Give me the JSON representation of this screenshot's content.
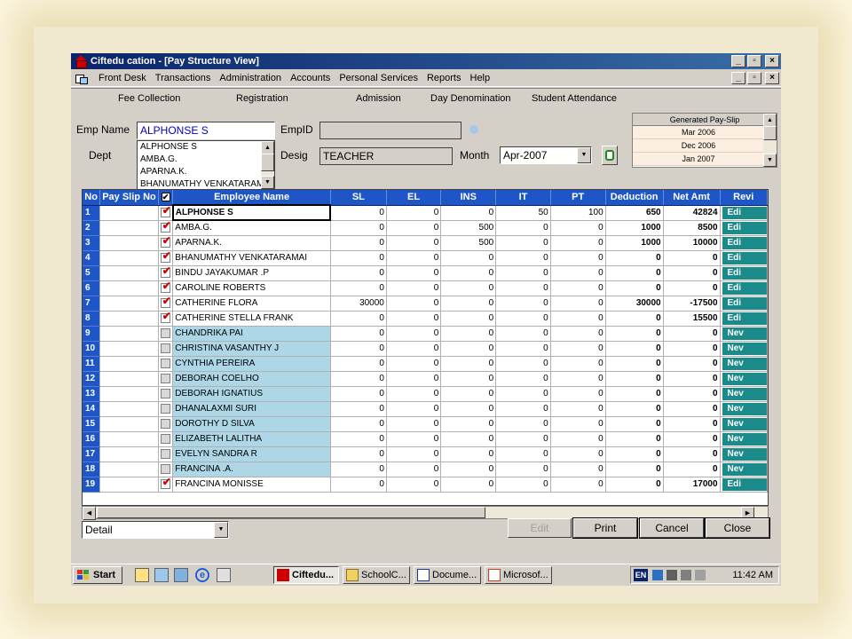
{
  "window": {
    "title": "Ciftedu cation - [Pay Structure View]"
  },
  "menu": [
    "Front Desk",
    "Transactions",
    "Administration",
    "Accounts",
    "Personal Services",
    "Reports",
    "Help"
  ],
  "toolbar": [
    "Fee Collection",
    "Registration",
    "Admission",
    "Day Denomination",
    "Student Attendance"
  ],
  "form": {
    "emp_name_label": "Emp Name",
    "emp_name_value": "ALPHONSE S",
    "empid_label": "EmpID",
    "empid_value": "",
    "dept_label": "Dept",
    "desig_label": "Desig",
    "desig_value": "TEACHER",
    "month_label": "Month",
    "month_value": "Apr-2007",
    "emp_list": [
      "ALPHONSE S",
      "AMBA.G.",
      "APARNA.K.",
      "BHANUMATHY VENKATARAMA"
    ]
  },
  "payslip": {
    "header": "Generated Pay-Slip",
    "items": [
      "Mar 2006",
      "Dec 2006",
      "Jan 2007"
    ]
  },
  "grid": {
    "headers": [
      "No",
      "Pay Slip No",
      "✔",
      "Employee Name",
      "SL",
      "EL",
      "INS",
      "IT",
      "PT",
      "Deduction",
      "Net Amt",
      "Revi"
    ],
    "rows": [
      {
        "no": "1",
        "checked": true,
        "name": "ALPHONSE S",
        "sl": "0",
        "el": "0",
        "ins": "0",
        "it": "50",
        "pt": "100",
        "ded": "650",
        "net": "42824",
        "action": "Edi"
      },
      {
        "no": "2",
        "checked": true,
        "name": "AMBA.G.",
        "sl": "0",
        "el": "0",
        "ins": "500",
        "it": "0",
        "pt": "0",
        "ded": "1000",
        "net": "8500",
        "action": "Edi"
      },
      {
        "no": "3",
        "checked": true,
        "name": "APARNA.K.",
        "sl": "0",
        "el": "0",
        "ins": "500",
        "it": "0",
        "pt": "0",
        "ded": "1000",
        "net": "10000",
        "action": "Edi"
      },
      {
        "no": "4",
        "checked": true,
        "name": "BHANUMATHY VENKATARAMAI",
        "sl": "0",
        "el": "0",
        "ins": "0",
        "it": "0",
        "pt": "0",
        "ded": "0",
        "net": "0",
        "action": "Edi"
      },
      {
        "no": "5",
        "checked": true,
        "name": "BINDU JAYAKUMAR .P",
        "sl": "0",
        "el": "0",
        "ins": "0",
        "it": "0",
        "pt": "0",
        "ded": "0",
        "net": "0",
        "action": "Edi"
      },
      {
        "no": "6",
        "checked": true,
        "name": "CAROLINE ROBERTS",
        "sl": "0",
        "el": "0",
        "ins": "0",
        "it": "0",
        "pt": "0",
        "ded": "0",
        "net": "0",
        "action": "Edi"
      },
      {
        "no": "7",
        "checked": true,
        "name": "CATHERINE FLORA",
        "sl": "30000",
        "el": "0",
        "ins": "0",
        "it": "0",
        "pt": "0",
        "ded": "30000",
        "net": "-17500",
        "action": "Edi"
      },
      {
        "no": "8",
        "checked": true,
        "name": "CATHERINE STELLA FRANK",
        "sl": "0",
        "el": "0",
        "ins": "0",
        "it": "0",
        "pt": "0",
        "ded": "0",
        "net": "15500",
        "action": "Edi"
      },
      {
        "no": "9",
        "checked": false,
        "name": "CHANDRIKA PAI",
        "sl": "0",
        "el": "0",
        "ins": "0",
        "it": "0",
        "pt": "0",
        "ded": "0",
        "net": "0",
        "action": "Nev"
      },
      {
        "no": "10",
        "checked": false,
        "name": "CHRISTINA VASANTHY J",
        "sl": "0",
        "el": "0",
        "ins": "0",
        "it": "0",
        "pt": "0",
        "ded": "0",
        "net": "0",
        "action": "Nev"
      },
      {
        "no": "11",
        "checked": false,
        "name": "CYNTHIA PEREIRA",
        "sl": "0",
        "el": "0",
        "ins": "0",
        "it": "0",
        "pt": "0",
        "ded": "0",
        "net": "0",
        "action": "Nev"
      },
      {
        "no": "12",
        "checked": false,
        "name": "DEBORAH COELHO",
        "sl": "0",
        "el": "0",
        "ins": "0",
        "it": "0",
        "pt": "0",
        "ded": "0",
        "net": "0",
        "action": "Nev"
      },
      {
        "no": "13",
        "checked": false,
        "name": "DEBORAH IGNATIUS",
        "sl": "0",
        "el": "0",
        "ins": "0",
        "it": "0",
        "pt": "0",
        "ded": "0",
        "net": "0",
        "action": "Nev"
      },
      {
        "no": "14",
        "checked": false,
        "name": "DHANALAXMI SURI",
        "sl": "0",
        "el": "0",
        "ins": "0",
        "it": "0",
        "pt": "0",
        "ded": "0",
        "net": "0",
        "action": "Nev"
      },
      {
        "no": "15",
        "checked": false,
        "name": "DOROTHY D SILVA",
        "sl": "0",
        "el": "0",
        "ins": "0",
        "it": "0",
        "pt": "0",
        "ded": "0",
        "net": "0",
        "action": "Nev"
      },
      {
        "no": "16",
        "checked": false,
        "name": "ELIZABETH LALITHA",
        "sl": "0",
        "el": "0",
        "ins": "0",
        "it": "0",
        "pt": "0",
        "ded": "0",
        "net": "0",
        "action": "Nev"
      },
      {
        "no": "17",
        "checked": false,
        "name": "EVELYN SANDRA R",
        "sl": "0",
        "el": "0",
        "ins": "0",
        "it": "0",
        "pt": "0",
        "ded": "0",
        "net": "0",
        "action": "Nev"
      },
      {
        "no": "18",
        "checked": false,
        "name": "FRANCINA .A.",
        "sl": "0",
        "el": "0",
        "ins": "0",
        "it": "0",
        "pt": "0",
        "ded": "0",
        "net": "0",
        "action": "Nev"
      },
      {
        "no": "19",
        "checked": true,
        "name": "FRANCINA MONISSE",
        "sl": "0",
        "el": "0",
        "ins": "0",
        "it": "0",
        "pt": "0",
        "ded": "0",
        "net": "17000",
        "action": "Edi"
      }
    ]
  },
  "bottom": {
    "view_select": "Detail",
    "edit_label": "Edit",
    "print_label": "Print",
    "cancel_label": "Cancel",
    "close_label": "Close"
  },
  "taskbar": {
    "start": "Start",
    "tasks": [
      "Ciftedu...",
      "SchoolC...",
      "Docume...",
      "Microsof..."
    ],
    "lang": "EN",
    "clock": "11:42 AM"
  },
  "colors": {
    "title_start": "#0a246a",
    "header_blue": "#1e56c8",
    "action_teal": "#1a8a8a",
    "check_red": "#d00000",
    "row_unchecked": "#add6e6"
  }
}
